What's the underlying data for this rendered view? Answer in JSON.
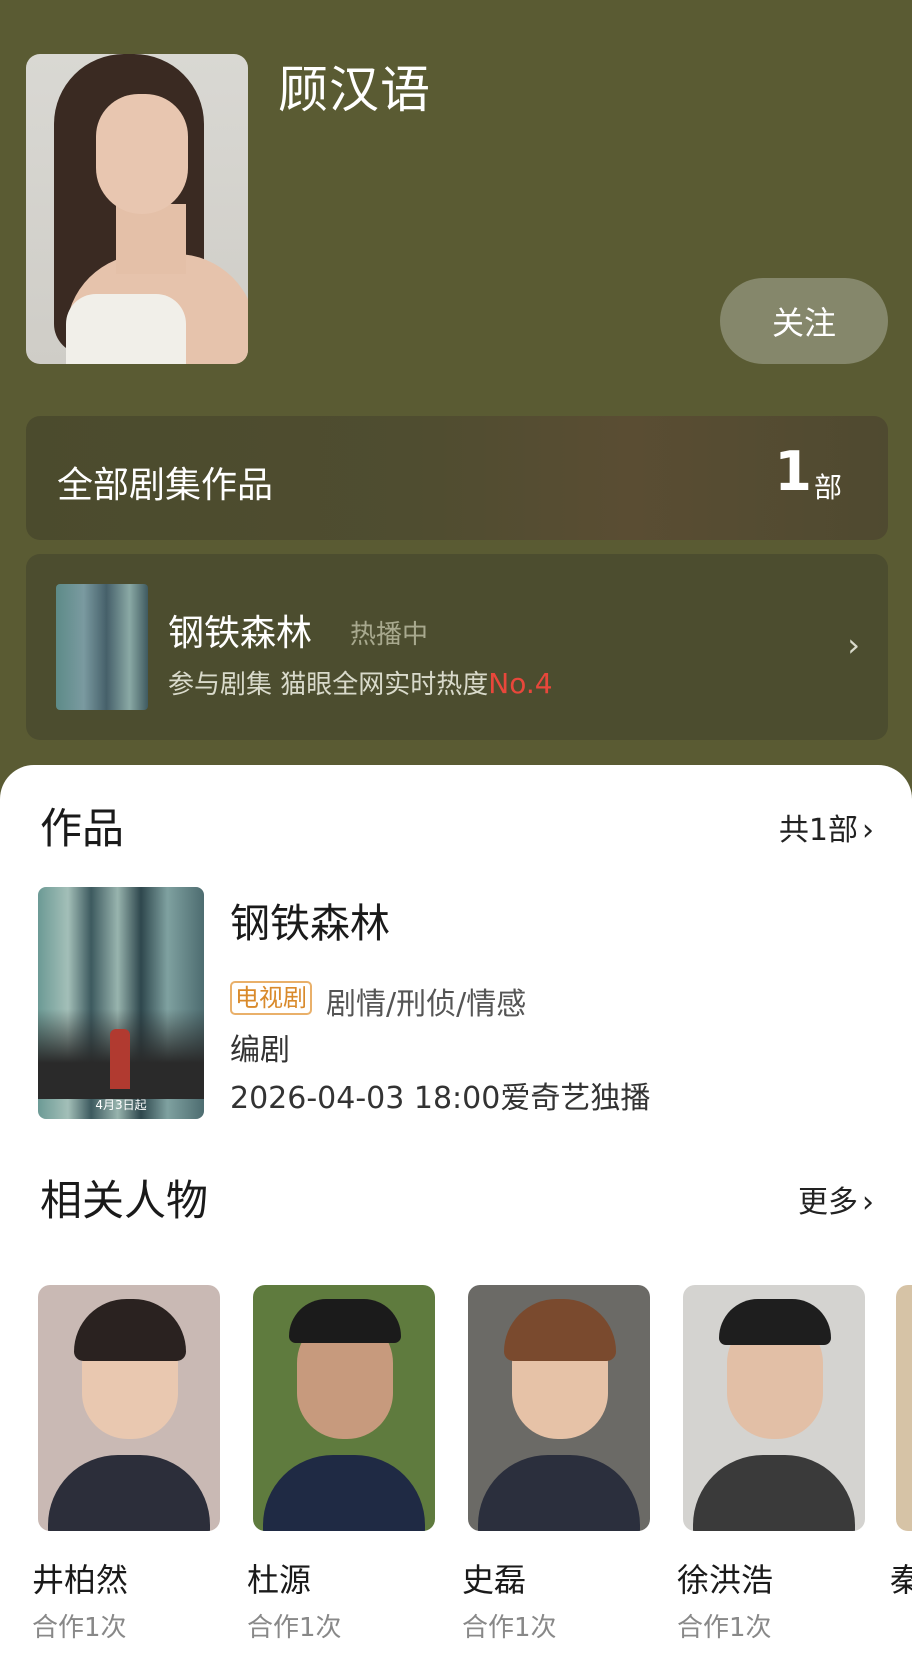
{
  "header": {
    "actor_name": "顾汉语",
    "follow_label": "关注"
  },
  "all_works": {
    "label": "全部剧集作品",
    "count": "1",
    "unit": "部"
  },
  "current_drama": {
    "title": "钢铁森林",
    "status": "热播中",
    "subtitle": "参与剧集 猫眼全网实时热度",
    "rank": "No.4",
    "poster_date": "4月3日起"
  },
  "works_section": {
    "title": "作品",
    "more": "共1部",
    "items": [
      {
        "title": "钢铁森林",
        "tag": "电视剧",
        "genre": "剧情/刑侦/情感",
        "role": "编剧",
        "date": "2026-04-03 18:00爱奇艺独播",
        "poster_date": "4月3日起"
      }
    ]
  },
  "people_section": {
    "title": "相关人物",
    "more": "更多",
    "people": [
      {
        "name": "井柏然",
        "collab": "合作1次"
      },
      {
        "name": "杜源",
        "collab": "合作1次"
      },
      {
        "name": "史磊",
        "collab": "合作1次"
      },
      {
        "name": "徐洪浩",
        "collab": "合作1次"
      }
    ],
    "partial_name": "秦"
  },
  "colors": {
    "header_bg": "#5a5b33",
    "rank_red": "#e8473b",
    "tag_orange": "#d98a2b"
  }
}
